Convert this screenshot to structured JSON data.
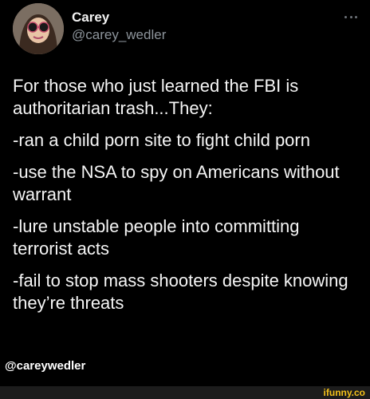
{
  "header": {
    "display_name": "Carey",
    "handle": "@carey_wedler",
    "more_icon": "more-horizontal-icon"
  },
  "tweet": {
    "lines": [
      "For those who just learned the FBI is authoritarian trash...They:",
      "-ran a child porn site to fight child porn",
      "-use the NSA to spy on Americans without warrant",
      "-lure unstable people into committing terrorist acts",
      "-fail to stop mass shooters despite knowing they’re threats"
    ]
  },
  "footer": {
    "handle": "@careywedler",
    "watermark": "ifunny.co"
  },
  "colors": {
    "background": "#000000",
    "handle_gray": "#8d949b",
    "watermark_yellow": "#f3c01a"
  }
}
